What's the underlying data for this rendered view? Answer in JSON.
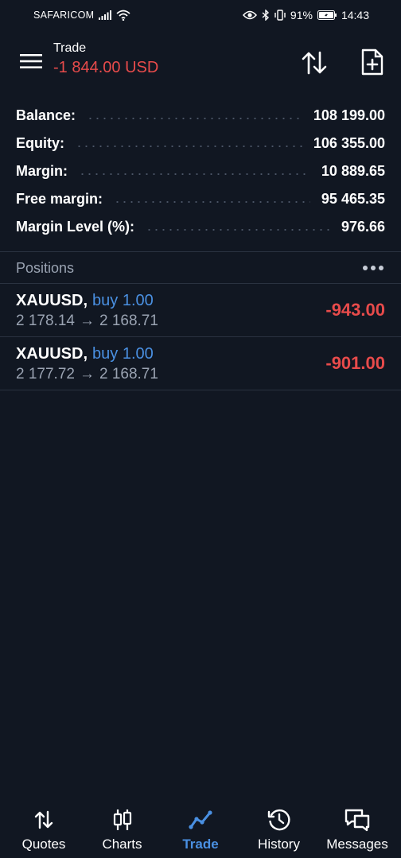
{
  "status_bar": {
    "carrier": "SAFARICOM",
    "battery": "91%",
    "time": "14:43"
  },
  "header": {
    "title": "Trade",
    "subtitle": "-1 844.00 USD",
    "icons": [
      "menu-icon",
      "sort-icon",
      "new-order-icon"
    ]
  },
  "summary": [
    {
      "label": "Balance:",
      "value": "108 199.00"
    },
    {
      "label": "Equity:",
      "value": "106 355.00"
    },
    {
      "label": "Margin:",
      "value": "10 889.65"
    },
    {
      "label": "Free margin:",
      "value": "95 465.35"
    },
    {
      "label": "Margin Level (%):",
      "value": "976.66"
    }
  ],
  "positions": {
    "header": "Positions",
    "items": [
      {
        "symbol": "XAUUSD,",
        "type": "buy 1.00",
        "open_price": "2 178.14",
        "arrow": "→",
        "current_price": "2 168.71",
        "profit": "-943.00"
      },
      {
        "symbol": "XAUUSD,",
        "type": "buy 1.00",
        "open_price": "2 177.72",
        "arrow": "→",
        "current_price": "2 168.71",
        "profit": "-901.00"
      }
    ]
  },
  "nav": {
    "items": [
      {
        "label": "Quotes",
        "icon": "quotes-icon"
      },
      {
        "label": "Charts",
        "icon": "charts-icon"
      },
      {
        "label": "Trade",
        "icon": "trade-icon",
        "active": true
      },
      {
        "label": "History",
        "icon": "history-icon"
      },
      {
        "label": "Messages",
        "icon": "messages-icon"
      }
    ]
  },
  "colors": {
    "background": "#111722",
    "loss": "#e84b4b",
    "accent": "#4a90e2",
    "muted": "#9aa3b2"
  }
}
